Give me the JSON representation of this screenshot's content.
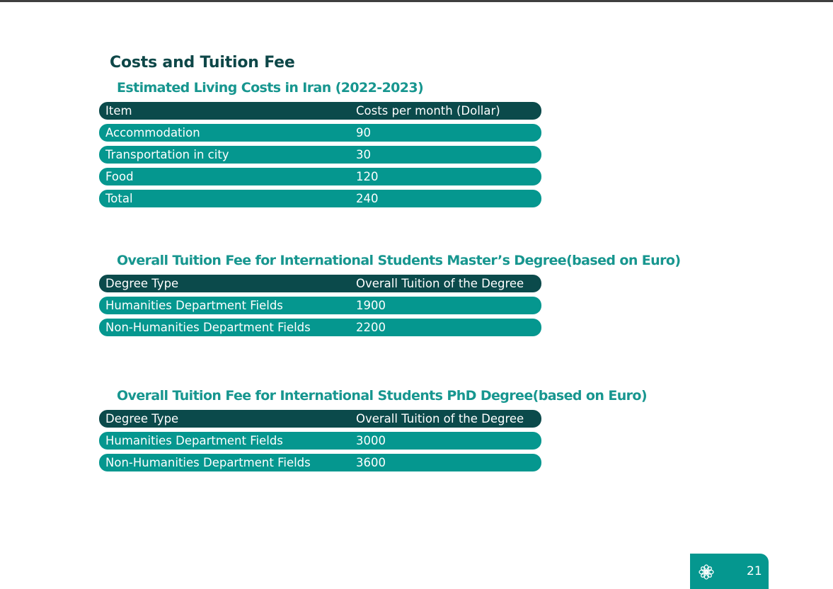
{
  "page": {
    "title": "Costs and Tuition Fee",
    "page_number": "21",
    "badge_icon": "flower-emblem-icon",
    "colors": {
      "header_row": "#0b4a4b",
      "body_row": "#05978f",
      "section_title": "#17968f",
      "page_title": "#0e4748"
    }
  },
  "living_costs": {
    "title": "Estimated Living Costs in Iran (2022-2023)",
    "columns": [
      "Item",
      "Costs per month (Dollar)"
    ],
    "rows": [
      [
        "Accommodation",
        "90"
      ],
      [
        "Transportation in city",
        "30"
      ],
      [
        "Food",
        "120"
      ],
      [
        "Total",
        "240"
      ]
    ]
  },
  "masters_tuition": {
    "title": "Overall Tuition Fee for International Students Master’s Degree(based on Euro)",
    "columns": [
      "Degree Type",
      "Overall Tuition of the Degree"
    ],
    "rows": [
      [
        "Humanities Department Fields",
        "1900"
      ],
      [
        "Non-Humanities Department Fields",
        "2200"
      ]
    ]
  },
  "phd_tuition": {
    "title": "Overall Tuition Fee for International Students PhD Degree(based on Euro)",
    "columns": [
      "Degree Type",
      "Overall Tuition of the Degree"
    ],
    "rows": [
      [
        "Humanities Department Fields",
        "3000"
      ],
      [
        "Non-Humanities Department Fields",
        "3600"
      ]
    ]
  }
}
